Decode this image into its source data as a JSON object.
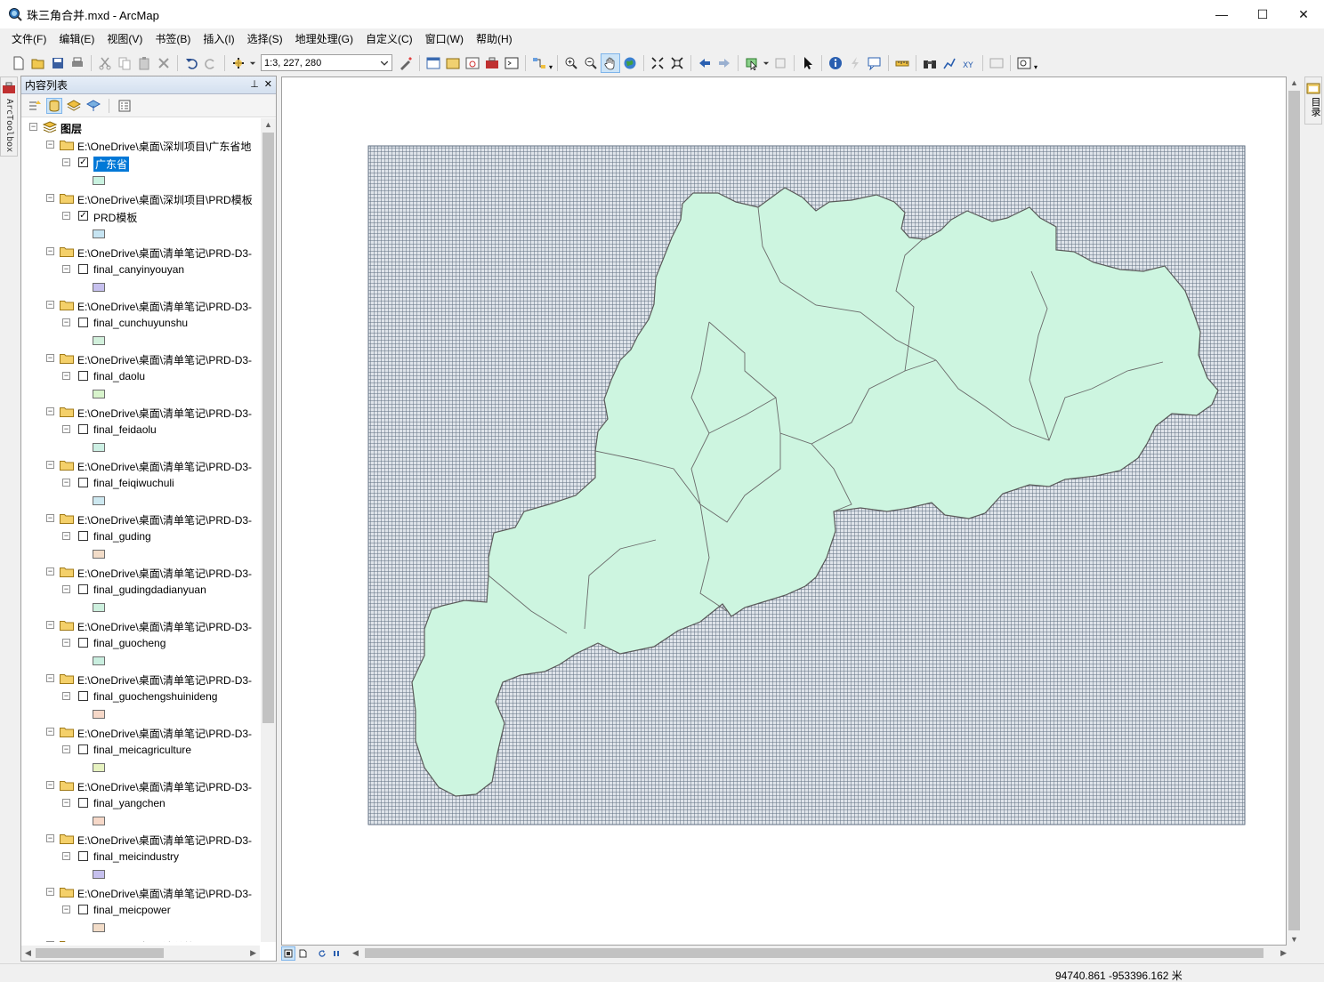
{
  "window": {
    "title": "珠三角合并.mxd - ArcMap"
  },
  "menu": [
    "文件(F)",
    "编辑(E)",
    "视图(V)",
    "书签(B)",
    "插入(I)",
    "选择(S)",
    "地理处理(G)",
    "自定义(C)",
    "窗口(W)",
    "帮助(H)"
  ],
  "toolbar": {
    "scale": "1:3, 227, 280"
  },
  "left_strip": {
    "label": "ArcToolbox"
  },
  "right_strip": {
    "label": "目录"
  },
  "toc": {
    "title": "内容列表",
    "root": "图层",
    "groups": [
      {
        "path": "E:\\OneDrive\\桌面\\深圳项目\\广东省地",
        "layer": "广东省",
        "checked": true,
        "selected": true,
        "color": "#c9f2e0"
      },
      {
        "path": "E:\\OneDrive\\桌面\\深圳项目\\PRD模板",
        "layer": "PRD模板",
        "checked": true,
        "selected": false,
        "color": "#c6e4f2"
      },
      {
        "path": "E:\\OneDrive\\桌面\\清单笔记\\PRD-D3-",
        "layer": "final_canyinyouyan",
        "checked": false,
        "selected": false,
        "color": "#c6c0ee"
      },
      {
        "path": "E:\\OneDrive\\桌面\\清单笔记\\PRD-D3-",
        "layer": "final_cunchuyunshu",
        "checked": false,
        "selected": false,
        "color": "#d2f0dc"
      },
      {
        "path": "E:\\OneDrive\\桌面\\清单笔记\\PRD-D3-",
        "layer": "final_daolu",
        "checked": false,
        "selected": false,
        "color": "#d8f4cc"
      },
      {
        "path": "E:\\OneDrive\\桌面\\清单笔记\\PRD-D3-",
        "layer": "final_feidaolu",
        "checked": false,
        "selected": false,
        "color": "#cdf0e4"
      },
      {
        "path": "E:\\OneDrive\\桌面\\清单笔记\\PRD-D3-",
        "layer": "final_feiqiwuchuli",
        "checked": false,
        "selected": false,
        "color": "#cde8f0"
      },
      {
        "path": "E:\\OneDrive\\桌面\\清单笔记\\PRD-D3-",
        "layer": "final_guding",
        "checked": false,
        "selected": false,
        "color": "#f2dcc8"
      },
      {
        "path": "E:\\OneDrive\\桌面\\清单笔记\\PRD-D3-",
        "layer": "final_gudingdadianyuan",
        "checked": false,
        "selected": false,
        "color": "#cdf0de"
      },
      {
        "path": "E:\\OneDrive\\桌面\\清单笔记\\PRD-D3-",
        "layer": "final_guocheng",
        "checked": false,
        "selected": false,
        "color": "#c9eedf"
      },
      {
        "path": "E:\\OneDrive\\桌面\\清单笔记\\PRD-D3-",
        "layer": "final_guochengshuinideng",
        "checked": false,
        "selected": false,
        "color": "#f6d8c8"
      },
      {
        "path": "E:\\OneDrive\\桌面\\清单笔记\\PRD-D3-",
        "layer": "final_meicagriculture",
        "checked": false,
        "selected": false,
        "color": "#e6f2c0"
      },
      {
        "path": "E:\\OneDrive\\桌面\\清单笔记\\PRD-D3-",
        "layer": "final_yangchen",
        "checked": false,
        "selected": false,
        "color": "#f6d8c8"
      },
      {
        "path": "E:\\OneDrive\\桌面\\清单笔记\\PRD-D3-",
        "layer": "final_meicindustry",
        "checked": false,
        "selected": false,
        "color": "#c6c0ee"
      },
      {
        "path": "E:\\OneDrive\\桌面\\清单笔记\\PRD-D3-",
        "layer": "final_meicpower",
        "checked": false,
        "selected": false,
        "color": "#f2dcc8"
      },
      {
        "path": "E:\\OneDrive\\桌面\\清单笔记\\PRD-D3-",
        "layer": "",
        "checked": false,
        "selected": false,
        "color": "#ffffff"
      }
    ]
  },
  "map": {
    "land_color": "#cdf5e0",
    "border_color": "#5a5a5a",
    "grid_color": "#5f6e80"
  },
  "status": {
    "coords": "94740.861  -953396.162 米"
  }
}
